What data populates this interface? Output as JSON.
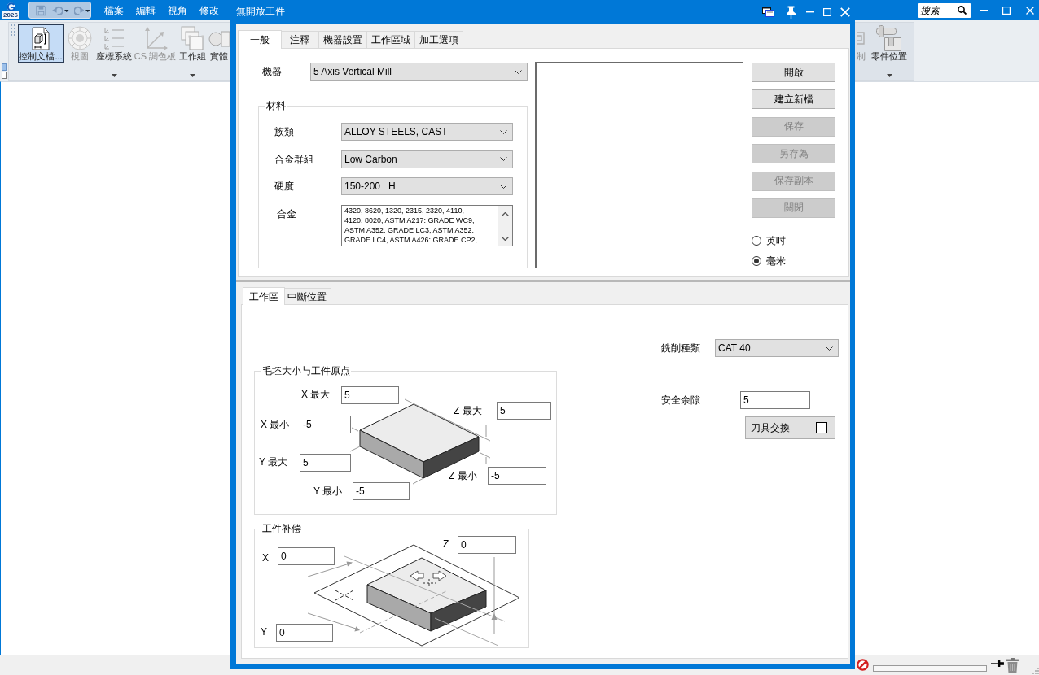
{
  "app_window": {
    "logo_text": "2026",
    "quick_access_toolbar": {
      "disabled": true
    },
    "menu_bar": [
      "檔案",
      "編輯",
      "視角",
      "修改"
    ],
    "search": {
      "placeholder": "搜索"
    },
    "ribbon": {
      "left_items": [
        {
          "label": "控制文檔...",
          "selected": true,
          "disabled": false,
          "menu": false
        },
        {
          "label": "視圖",
          "selected": false,
          "disabled": true,
          "menu": false
        },
        {
          "label": "座標系統",
          "selected": false,
          "disabled": false,
          "menu": true
        },
        {
          "label": "CS 調色板",
          "selected": false,
          "disabled": true,
          "menu": false
        },
        {
          "label": "工作組",
          "selected": false,
          "disabled": false,
          "menu": true
        },
        {
          "label": "實體",
          "selected": false,
          "disabled": false,
          "menu": false
        }
      ],
      "right_items": [
        {
          "label": "制",
          "selected": false,
          "disabled": true,
          "menu": false
        },
        {
          "label": "零件位置",
          "selected": false,
          "disabled": false,
          "menu": true
        }
      ]
    }
  },
  "dialog": {
    "title": "無開放工件",
    "tabs": [
      {
        "label": "一般",
        "selected": true
      },
      {
        "label": "注釋",
        "selected": false
      },
      {
        "label": "機器設置",
        "selected": false
      },
      {
        "label": "工作區域",
        "selected": false
      },
      {
        "label": "加工選項",
        "selected": false
      }
    ],
    "machine": {
      "label": "機器",
      "value": "5 Axis Vertical Mill"
    },
    "material": {
      "title": "材料",
      "fields": [
        {
          "kind": "dropdown",
          "label": "族類",
          "value": "ALLOY STEELS, CAST"
        },
        {
          "kind": "dropdown",
          "label": "合金群組",
          "value": "Low Carbon"
        },
        {
          "kind": "dropdown",
          "label": "硬度",
          "value": "150-200   H"
        },
        {
          "kind": "list",
          "label": "合金",
          "lines": [
            "4320, 8620, 1320, 2315, 2320, 4110,",
            "4120, 8020, ASTM A217: GRADE WC9,",
            "ASTM A352: GRADE LC3, ASTM A352:",
            "GRADE LC4, ASTM A426: GRADE CP2,"
          ]
        }
      ]
    },
    "file_buttons": [
      {
        "label": "開啟",
        "disabled": false
      },
      {
        "label": "建立新檔",
        "disabled": false
      },
      {
        "label": "保存",
        "disabled": true
      },
      {
        "label": "另存為",
        "disabled": true
      },
      {
        "label": "保存副本",
        "disabled": true
      },
      {
        "label": "關閉",
        "disabled": true
      }
    ],
    "units": [
      {
        "label": "英吋",
        "selected": false
      },
      {
        "label": "毫米",
        "selected": true
      }
    ],
    "lower_tabs": [
      {
        "label": "工作區",
        "selected": true
      },
      {
        "label": "中斷位置",
        "selected": false
      }
    ],
    "stock": {
      "title": "毛坯大小与工件原点",
      "fields": [
        {
          "label": "X 最大",
          "value": "5"
        },
        {
          "label": "Z 最大",
          "value": "5"
        },
        {
          "label": "X 最小",
          "value": "-5"
        },
        {
          "label": "Y 最大",
          "value": "5"
        },
        {
          "label": "Z 最小",
          "value": "-5"
        },
        {
          "label": "Y 最小",
          "value": "-5"
        }
      ]
    },
    "work_offset": {
      "title": "工件补偿",
      "fields": [
        {
          "label": "Z",
          "value": "0"
        },
        {
          "label": "X",
          "value": "0"
        },
        {
          "label": "Y",
          "value": "0"
        }
      ]
    },
    "cutter_type": {
      "label": "銑削種類",
      "value": "CAT 40"
    },
    "clearance": {
      "label": "安全余隙",
      "value": "5"
    },
    "tool_change": {
      "label": "刀具交換",
      "checked": false
    }
  },
  "status_bar": {
    "progress": {
      "level": 0
    }
  }
}
